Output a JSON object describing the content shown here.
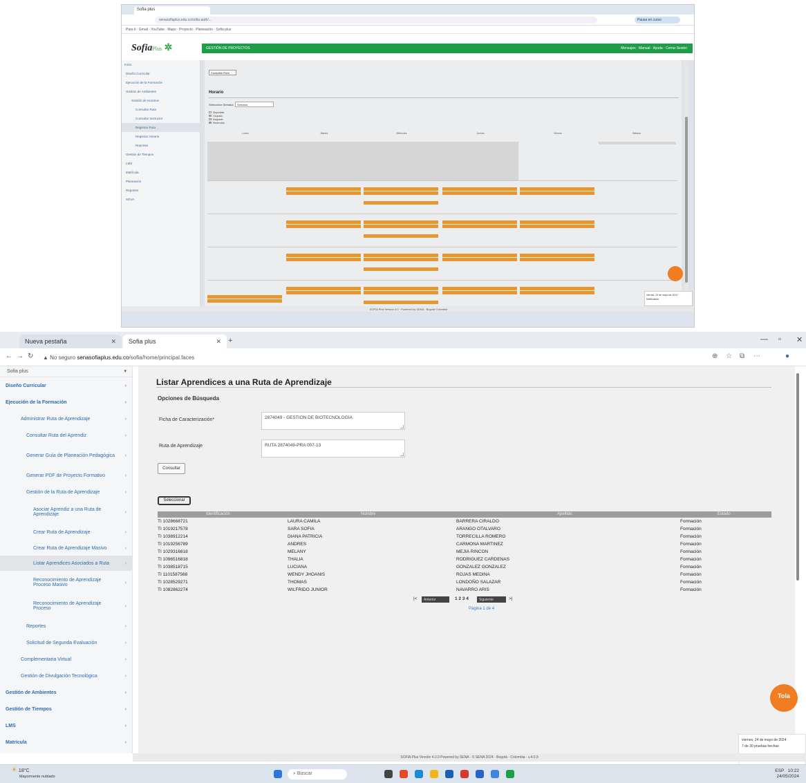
{
  "top": {
    "tab_title": "Sofia plus",
    "url": "senasofiaplus.edu.co/sofia-auth/...",
    "profile_label": "Pausa en curso",
    "bookmarks": "Para ti · Gmail · YouTube · Maps · Proyecto · Planeación · Sofia plus",
    "logo": "Sofia",
    "logo_suffix": "Plus",
    "green_bar_title": "GESTIÓN DE PROYECTOS",
    "green_bar_right": "Mensajes · Manual · Ayuda · Cerrar Sesión",
    "side_items": [
      "Inicio",
      "Diseño Curricular",
      "Ejecución de la Formación",
      "Gestión de Ambientes",
      "Gestión de Horarios",
      "Consultar Ruta",
      "Consultar Instructor",
      "Registrar Ruta",
      "Registrar Horario",
      "Reportes",
      "Gestión de Tiempos",
      "LMS",
      "Matrícula",
      "Planeación",
      "Reportes",
      "SGVA"
    ],
    "button": "Consultar Ruta",
    "section_title": "Horario",
    "filter_label": "Seleccione Semana",
    "filter_value": "Semana",
    "legend": [
      "Disponible",
      "Ocupado",
      "Asignado",
      "Reservado"
    ],
    "days": [
      "Lunes",
      "Martes",
      "Miércoles",
      "Jueves",
      "Viernes",
      "Sábado"
    ],
    "status": "SOFIA Plus Version 4.0 · Powered by SENA · Bogotá Colombia",
    "toast": "viernes, 24 de mayo de 2024 · Notificación"
  },
  "browser": {
    "tab1": "Nueva pestaña",
    "tab2": "Sofia plus",
    "url_prefix": "No seguro",
    "url_host": "senasofiaplus.edu.co",
    "url_path": "/sofia/home/principal.faces"
  },
  "sidebar": {
    "search": "Sofia plus",
    "items": [
      {
        "label": "Diseño Curricular",
        "bold": true
      },
      {
        "label": "Ejecución de la Formación",
        "bold": true
      },
      {
        "label": "Administrar Ruta de Aprendizaje"
      },
      {
        "label": "Consultar Ruta del Aprendiz"
      },
      {
        "label": "Generar Guía de Planeación Pedagógica"
      },
      {
        "label": "Generar PDF de Proyecto Formativo"
      },
      {
        "label": "Gestión de la Ruta de Aprendizaje"
      },
      {
        "label": "Asociar Aprendiz a una Ruta de Aprendizaje"
      },
      {
        "label": "Crear Ruta de Aprendizaje"
      },
      {
        "label": "Crear Ruta de Aprendizaje Masivo"
      },
      {
        "label": "Listar Aprendices Asociados a Ruta"
      },
      {
        "label": "Reconocimiento de Aprendizaje Proceso Masivo"
      },
      {
        "label": "Reconocimiento de Aprendizaje Proceso"
      },
      {
        "label": "Reportes"
      },
      {
        "label": "Solicitud de Segunda Evaluación"
      },
      {
        "label": "Complementaria Virtual"
      },
      {
        "label": "Gestión de Divulgación Tecnológica"
      },
      {
        "label": "Gestión de Ambientes",
        "bold": true
      },
      {
        "label": "Gestión de Tiempos",
        "bold": true
      },
      {
        "label": "LMS",
        "bold": true
      },
      {
        "label": "Matrícula",
        "bold": true
      }
    ]
  },
  "page": {
    "title": "Listar Aprendices a una Ruta de Aprendizaje",
    "options_title": "Opciones de Búsqueda",
    "field1_label": "Ficha de Caracterización*",
    "field1_value": "2874049 - GESTION DE BIOTECNOLOGIA",
    "field2_label": "Ruta de Aprendizaje",
    "field2_value": "RUTA 2874049-PRA 007-13",
    "consult_button": "Consultar",
    "select_button": "Seleccionar",
    "columns": [
      "Identificación",
      "Nombre",
      "Apellido",
      "Estado"
    ],
    "rows": [
      [
        "TI 1028668721",
        "LAURA CAMILA",
        "BARRERA CIRALDO",
        "Formación"
      ],
      [
        "TI 1019217578",
        "SARA SOFIA",
        "ARANGO OTALVARO",
        "Formación"
      ],
      [
        "TI 1038912214",
        "DIANA PATRICIA",
        "TORRECILLA ROMERO",
        "Formación"
      ],
      [
        "TI 1019256789",
        "ANDRES",
        "CARMONA MARTINEZ",
        "Formación"
      ],
      [
        "TI 1029316818",
        "MELANY",
        "MEJIA RINCON",
        "Formación"
      ],
      [
        "TI 1096516818",
        "THALIA",
        "RODRIGUEZ CARDENAS",
        "Formación"
      ],
      [
        "TI 1038518715",
        "LUCIANA",
        "GONZALEZ GONZALEZ",
        "Formación"
      ],
      [
        "TI 1101587568",
        "WENDY JHOANIS",
        "ROJAS MEDINA",
        "Formación"
      ],
      [
        "TI 1028529271",
        "THOMAS",
        "LONDOÑO SALAZAR",
        "Formación"
      ],
      [
        "TI 1082862274",
        "WILFRIDO JUNIOR",
        "NAVARRO ARIS",
        "Formación"
      ]
    ],
    "pager_first": "|<",
    "pager_prev": "Anterior",
    "pager_pages": "1 2 3 4",
    "pager_next": "Siguiente",
    "pager_last": ">|",
    "page_info": "Página 1 de 4"
  },
  "footer": {
    "status": "SOFIA Plus Versión 4.0.9 Powered by SENA · © SENA 2024 · Bogotá · Colombia · v.4.0.9",
    "notif_line1": "viernes, 24 de mayo de 2024",
    "notif_line2": "7 de 30 pruebas hechas",
    "badge": "Tola"
  },
  "taskbar": {
    "weather_temp": "18°C",
    "weather_desc": "Mayormente nublado",
    "search": "Buscar",
    "lang": "ESP",
    "time": "10:22",
    "date": "24/05/2024"
  }
}
